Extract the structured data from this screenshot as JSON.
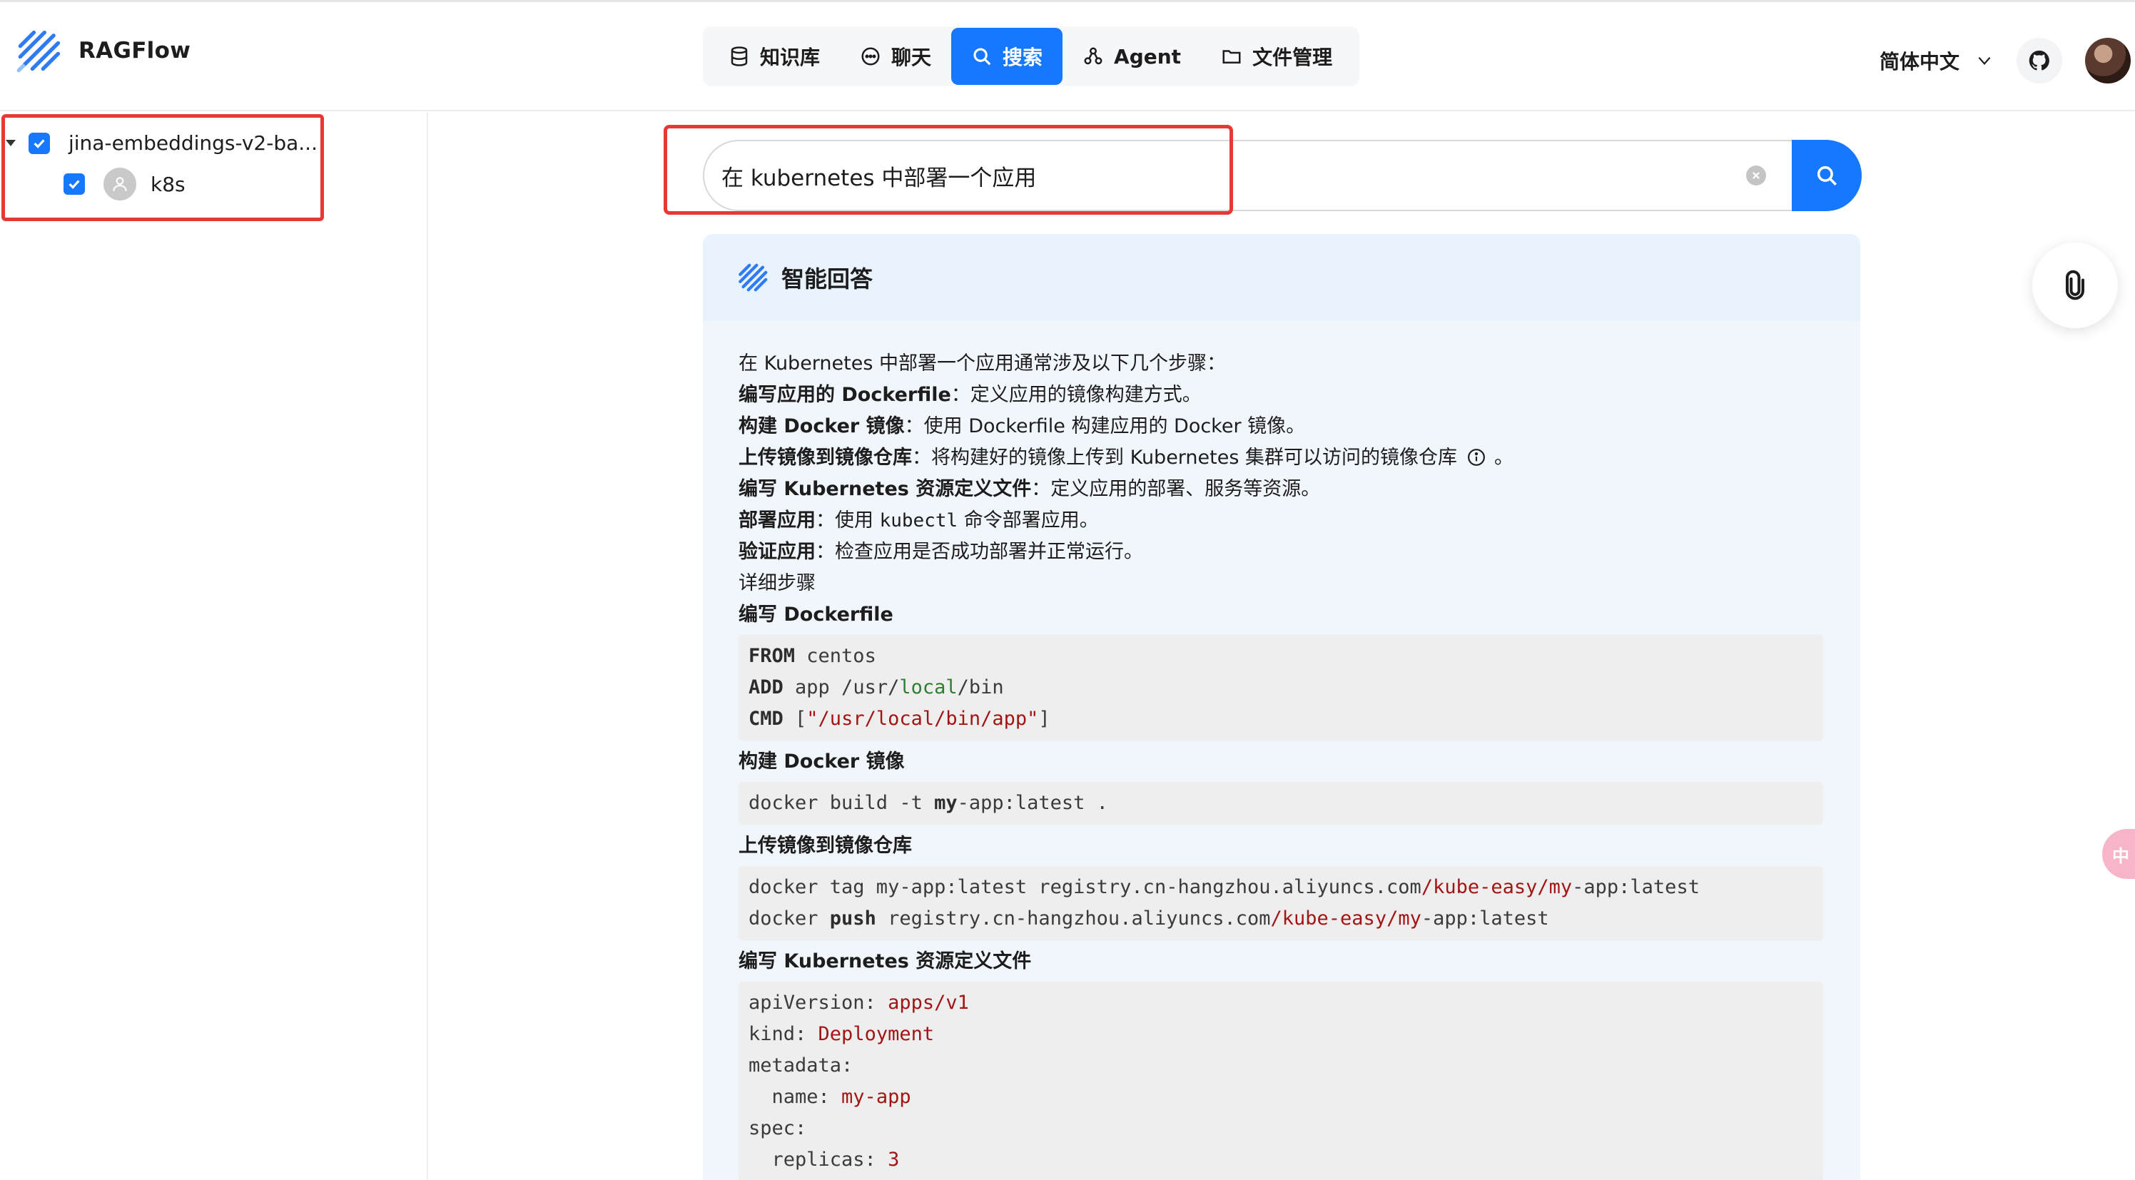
{
  "app": {
    "name": "RAGFlow"
  },
  "nav": {
    "items": [
      {
        "label": "知识库",
        "icon": "database-icon",
        "active": false
      },
      {
        "label": "聊天",
        "icon": "chat-icon",
        "active": false
      },
      {
        "label": "搜索",
        "icon": "search-icon",
        "active": true
      },
      {
        "label": "Agent",
        "icon": "agent-graph-icon",
        "active": false
      },
      {
        "label": "文件管理",
        "icon": "folder-icon",
        "active": false
      }
    ],
    "accent": "#1677ff"
  },
  "header": {
    "language": "简体中文"
  },
  "sidebar": {
    "tree": {
      "root": {
        "label": "jina-embeddings-v2-ba...",
        "checked": true
      },
      "children": [
        {
          "label": "k8s",
          "checked": true
        }
      ]
    }
  },
  "search": {
    "query": "在 kubernetes 中部署一个应用"
  },
  "answer": {
    "title": "智能回答",
    "intro": "在 Kubernetes 中部署一个应用通常涉及以下几个步骤：",
    "steps": [
      {
        "bold": "编写应用的 Dockerfile",
        "text": "：定义应用的镜像构建方式。"
      },
      {
        "bold": "构建 Docker 镜像",
        "text": "：使用 Dockerfile 构建应用的 Docker 镜像。"
      },
      {
        "bold": "上传镜像到镜像仓库",
        "text": "：将构建好的镜像上传到 Kubernetes 集群可以访问的镜像仓库",
        "suffix": "。"
      },
      {
        "bold": "编写 Kubernetes 资源定义文件",
        "text": "：定义应用的部署、服务等资源。"
      },
      {
        "bold": "部署应用",
        "text_before": "：使用 ",
        "code": "kubectl",
        "text_after": " 命令部署应用。"
      },
      {
        "bold": "验证应用",
        "text": "：检查应用是否成功部署并正常运行。"
      }
    ],
    "details_label": "详细步骤",
    "sections": {
      "dockerfile": "编写 Dockerfile",
      "build": "构建 Docker 镜像",
      "push": "上传镜像到镜像仓库",
      "k8s": "编写 Kubernetes 资源定义文件"
    },
    "code": {
      "dockerfile": {
        "l1_kw": "FROM",
        "l1_rest": " centos",
        "l2_kw": "ADD",
        "l2_a": " app /usr/",
        "l2_grn": "local",
        "l2_b": "/bin",
        "l3_kw": "CMD",
        "l3_a": " [",
        "l3_str": "\"/usr/local/bin/app\"",
        "l3_b": "]"
      },
      "build": {
        "a": "docker build -t ",
        "b": "my",
        "c": "-app:latest ."
      },
      "push": {
        "l1_a": "docker tag my-app:latest registry.cn-hangzhou.aliyuncs.com",
        "l1_red": "/kube-easy/my",
        "l1_b": "-app:latest",
        "l2_a": "docker ",
        "l2_kw": "push",
        "l2_b": " registry.cn-hangzhou.aliyuncs.com",
        "l2_red": "/kube-easy/my",
        "l2_c": "-app:latest"
      },
      "yaml": {
        "l1_k": "apiVersion: ",
        "l1_v": "apps/v1",
        "l2_k": "kind: ",
        "l2_v": "Deployment",
        "l3_k": "metadata:",
        "l4_k": "  name: ",
        "l4_v": "my-app",
        "l5_k": "spec:",
        "l6_k": "  replicas: ",
        "l6_v": "3"
      }
    }
  },
  "floating": {
    "side_text": "中"
  }
}
